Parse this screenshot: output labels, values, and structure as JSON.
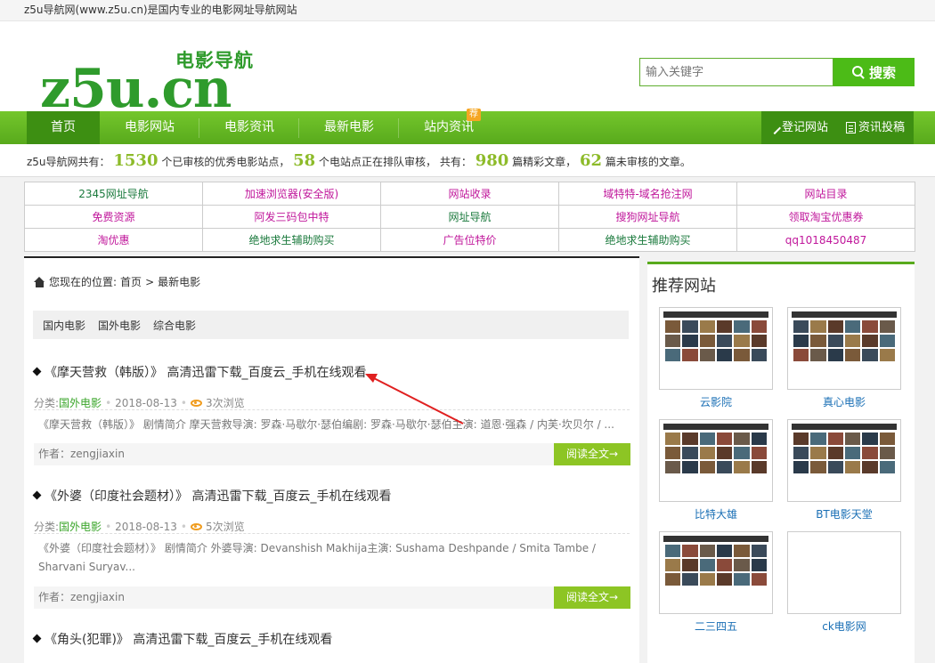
{
  "topbar": {
    "text": "z5u导航网(www.z5u.cn)是国内专业的电影网址导航网站"
  },
  "logo": {
    "main": "z5u.cn",
    "sub": "电影导航"
  },
  "search": {
    "placeholder": "输入关键字",
    "button": "搜索"
  },
  "nav": {
    "items": [
      "首页",
      "电影网站",
      "电影资讯",
      "最新电影",
      "站内资讯"
    ],
    "badge": "荐",
    "register": "登记网站",
    "submit": "资讯投稿"
  },
  "stats": {
    "prefix": "z5u导航网共有：",
    "n1": "1530",
    "t1": "个已审核的优秀电影站点，",
    "n2": "58",
    "t2": "个电站点正在排队审核，  共有：",
    "n3": "980",
    "t3": "篇精彩文章，",
    "n4": "62",
    "t4": "篇未审核的文章。"
  },
  "links": [
    [
      {
        "t": "2345网址导航",
        "c": "#1b7a3d"
      },
      {
        "t": "加速浏览器(安全版)",
        "c": "#c0179b"
      },
      {
        "t": "网站收录",
        "c": "#c0179b"
      },
      {
        "t": "域特特-域名抢注网",
        "c": "#c0179b"
      },
      {
        "t": "网站目录",
        "c": "#c0179b"
      }
    ],
    [
      {
        "t": "免费资源",
        "c": "#c0179b"
      },
      {
        "t": "阿发三码包中特",
        "c": "#c0179b"
      },
      {
        "t": "网址导航",
        "c": "#1b7a3d"
      },
      {
        "t": "搜狗网址导航",
        "c": "#c0179b"
      },
      {
        "t": "领取淘宝优惠券",
        "c": "#c0179b"
      }
    ],
    [
      {
        "t": "淘优惠",
        "c": "#c0179b"
      },
      {
        "t": "绝地求生辅助购买",
        "c": "#1b7a3d"
      },
      {
        "t": "广告位特价",
        "c": "#c0179b"
      },
      {
        "t": "绝地求生辅助购买",
        "c": "#1b7a3d"
      },
      {
        "t": "qq1018450487",
        "c": "#c0179b"
      }
    ]
  ],
  "breadcrumb": {
    "label": "您现在的位置:",
    "home": "首页",
    "sep": ">",
    "current": "最新电影"
  },
  "subnav": [
    "国内电影",
    "国外电影",
    "综合电影"
  ],
  "articles": [
    {
      "title": "《摩天营救（韩版）》 高清迅雷下载_百度云_手机在线观看",
      "cat_label": "分类:",
      "cat": "国外电影",
      "date": "2018-08-13",
      "views": "3次浏览",
      "summary": "《摩天营救（韩版）》 剧情简介 摩天营救导演: 罗森·马歇尔·瑟伯编剧: 罗森·马歇尔·瑟伯主演: 道恩·强森 / 内芙·坎贝尔 / ...",
      "author": "作者：zengjiaxin",
      "read": "阅读全文→"
    },
    {
      "title": "《外婆（印度社会题材）》 高清迅雷下载_百度云_手机在线观看",
      "cat_label": "分类:",
      "cat": "国外电影",
      "date": "2018-08-13",
      "views": "5次浏览",
      "summary": "《外婆（印度社会题材）》 剧情简介 外婆导演: Devanshish Makhija主演: Sushama Deshpande / Smita Tambe / Sharvani Suryav...",
      "author": "作者：zengjiaxin",
      "read": "阅读全文→"
    },
    {
      "title": "《角头(犯罪)》 高清迅雷下载_百度云_手机在线观看"
    }
  ],
  "sidebar": {
    "title": "推荐网站",
    "sites": [
      "云影院",
      "真心电影",
      "比特大雄",
      "BT电影天堂",
      "二三四五",
      "ck电影网"
    ]
  },
  "colors": {
    "green": "#58aa1c",
    "accent": "#8dc524",
    "link_green": "#1b7a3d",
    "link_pink": "#c0179b"
  }
}
